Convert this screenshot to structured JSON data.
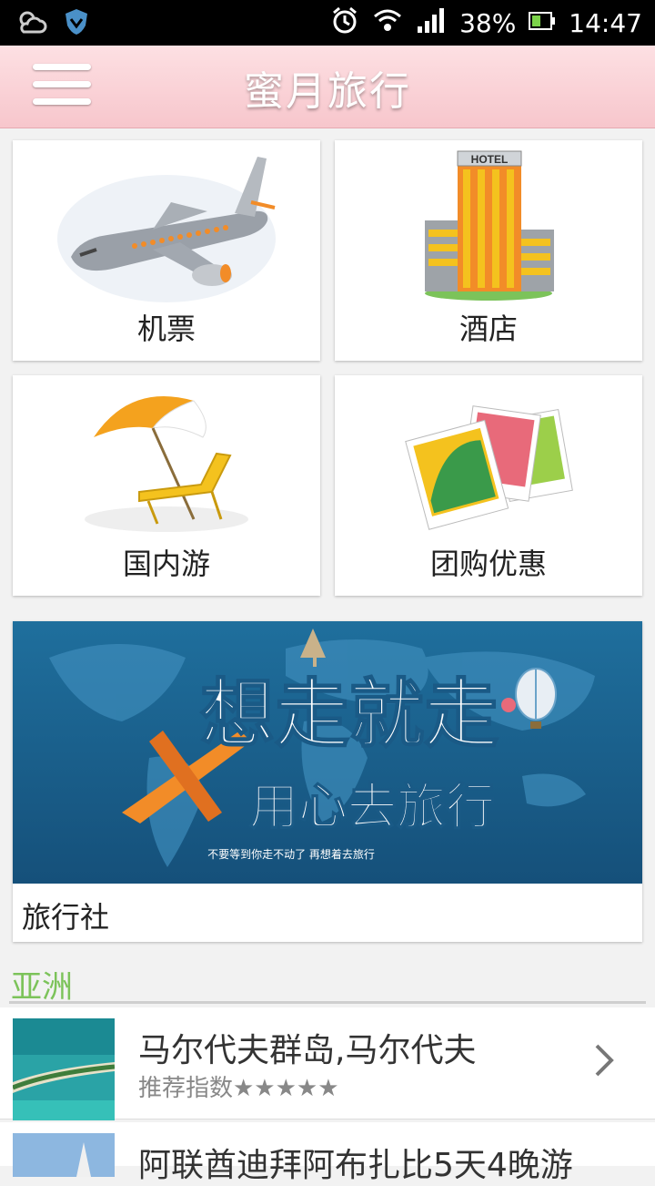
{
  "status": {
    "battery": "38%",
    "time": "14:47"
  },
  "header": {
    "title": "蜜月旅行"
  },
  "tiles": [
    {
      "label": "机票",
      "icon": "airplane-icon"
    },
    {
      "label": "酒店",
      "icon": "hotel-icon"
    },
    {
      "label": "国内游",
      "icon": "beach-umbrella-icon"
    },
    {
      "label": "团购优惠",
      "icon": "photos-icon"
    }
  ],
  "banner": {
    "headline": "想走就走",
    "subheadline": "用心去旅行",
    "tagline": "不要等到你走不动了 再想着去旅行",
    "label": "旅行社"
  },
  "section": {
    "title": "亚洲"
  },
  "destinations": [
    {
      "name": "马尔代夫群岛,马尔代夫",
      "rating": "推荐指数★★★★★"
    },
    {
      "name": "阿联酋迪拜阿布扎比5天4晚游"
    }
  ],
  "colors": {
    "header_pink": "#f7c6cc",
    "section_green": "#7cc35a",
    "banner_blue": "#1f6f9d"
  }
}
